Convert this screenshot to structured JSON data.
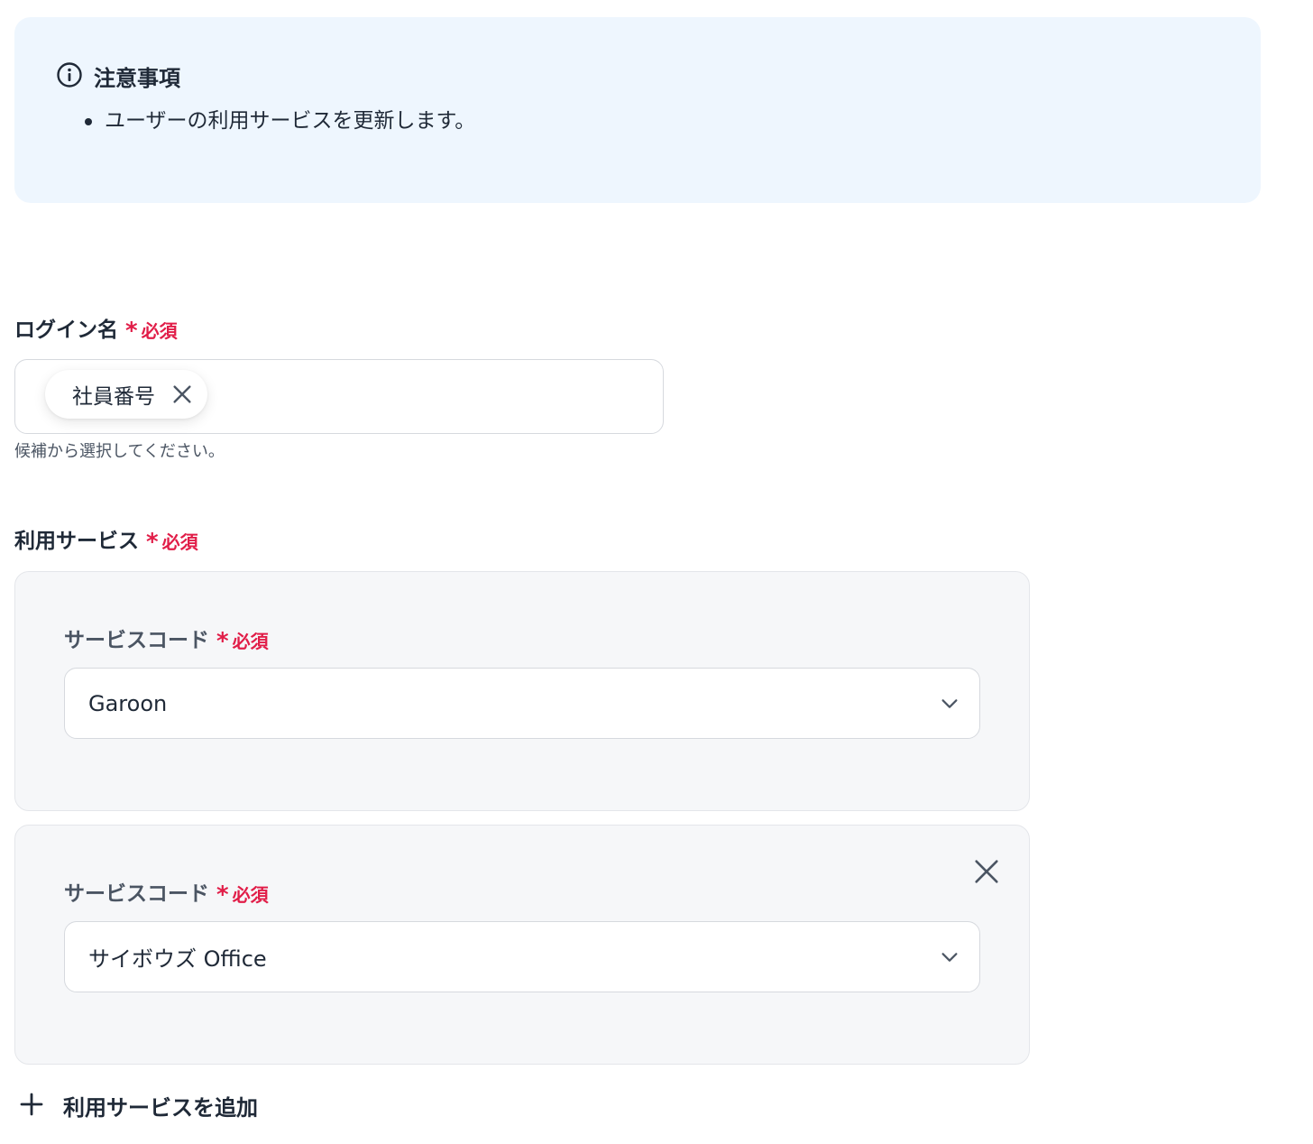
{
  "notice": {
    "icon": "info-circle-icon",
    "title": "注意事項",
    "items": [
      "ユーザーの利用サービスを更新します。"
    ]
  },
  "login_field": {
    "label": "ログイン名",
    "required_star": "*",
    "required_text": "必須",
    "chip_value": "社員番号",
    "hint": "候補から選択してください。"
  },
  "services_field": {
    "label": "利用サービス",
    "required_star": "*",
    "required_text": "必須",
    "cards": [
      {
        "label": "サービスコード",
        "required_star": "*",
        "required_text": "必須",
        "value": "Garoon"
      },
      {
        "label": "サービスコード",
        "required_star": "*",
        "required_text": "必須",
        "value": "サイボウズ Office"
      }
    ],
    "add_label": "利用サービスを追加"
  },
  "colors": {
    "notice_bg": "#eef6fe",
    "required": "#e11d48",
    "card_bg": "#f6f7f9"
  }
}
